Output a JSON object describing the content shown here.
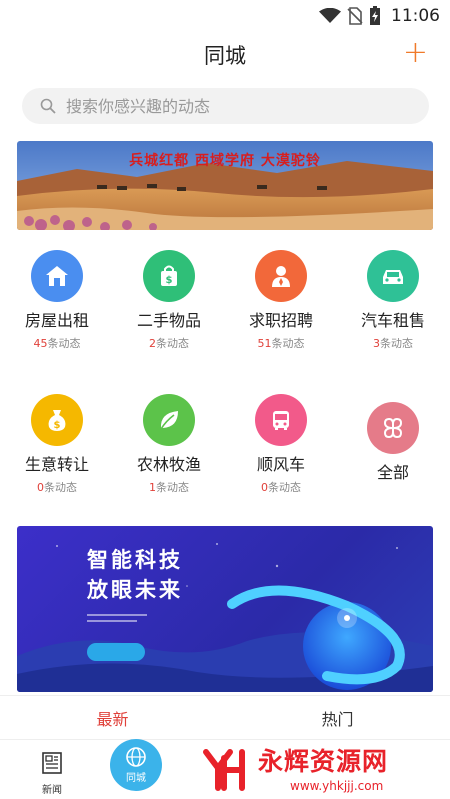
{
  "status_bar": {
    "time": "11:06",
    "icons": [
      "wifi-icon",
      "no-sim-icon",
      "battery-charging-icon"
    ]
  },
  "header": {
    "title": "同城",
    "add_label": "+"
  },
  "search": {
    "placeholder": "搜索你感兴趣的动态",
    "icon": "search-icon"
  },
  "banner_top": {
    "caption": "兵城红都 西域学府 大漠驼铃"
  },
  "categories": [
    {
      "label": "房屋出租",
      "count": "45",
      "suffix": "条动态",
      "icon": "house-icon",
      "color": "#4a8ef0"
    },
    {
      "label": "二手物品",
      "count": "2",
      "suffix": "条动态",
      "icon": "shopping-bag-icon",
      "color": "#2fbf78"
    },
    {
      "label": "求职招聘",
      "count": "51",
      "suffix": "条动态",
      "icon": "person-tie-icon",
      "color": "#f2683a"
    },
    {
      "label": "汽车租售",
      "count": "3",
      "suffix": "条动态",
      "icon": "car-icon",
      "color": "#2fc196"
    },
    {
      "label": "生意转让",
      "count": "0",
      "suffix": "条动态",
      "icon": "money-bag-icon",
      "color": "#f5b800"
    },
    {
      "label": "农林牧渔",
      "count": "1",
      "suffix": "条动态",
      "icon": "leaf-icon",
      "color": "#5cc34a"
    },
    {
      "label": "顺风车",
      "count": "0",
      "suffix": "条动态",
      "icon": "bus-icon",
      "color": "#f25a8a"
    },
    {
      "label": "全部",
      "icon": "all-categories-icon",
      "color": "#e57b89"
    }
  ],
  "banner_bottom": {
    "line1": "智能科技",
    "line2": "放眼未来"
  },
  "tabs": [
    {
      "label": "最新",
      "active": true
    },
    {
      "label": "热门",
      "active": false
    }
  ],
  "bottom_nav": {
    "items": [
      {
        "label": "新闻",
        "icon": "news-icon"
      },
      {
        "label": "同城",
        "icon": "city-globe-icon",
        "active": true
      }
    ]
  },
  "watermark": {
    "brand": "永辉资源网",
    "url": "www.yhkjjj.com"
  },
  "colors": {
    "accent_orange": "#f07a2a",
    "accent_red": "#e0413a",
    "nav_blue": "#3bb3ea"
  }
}
